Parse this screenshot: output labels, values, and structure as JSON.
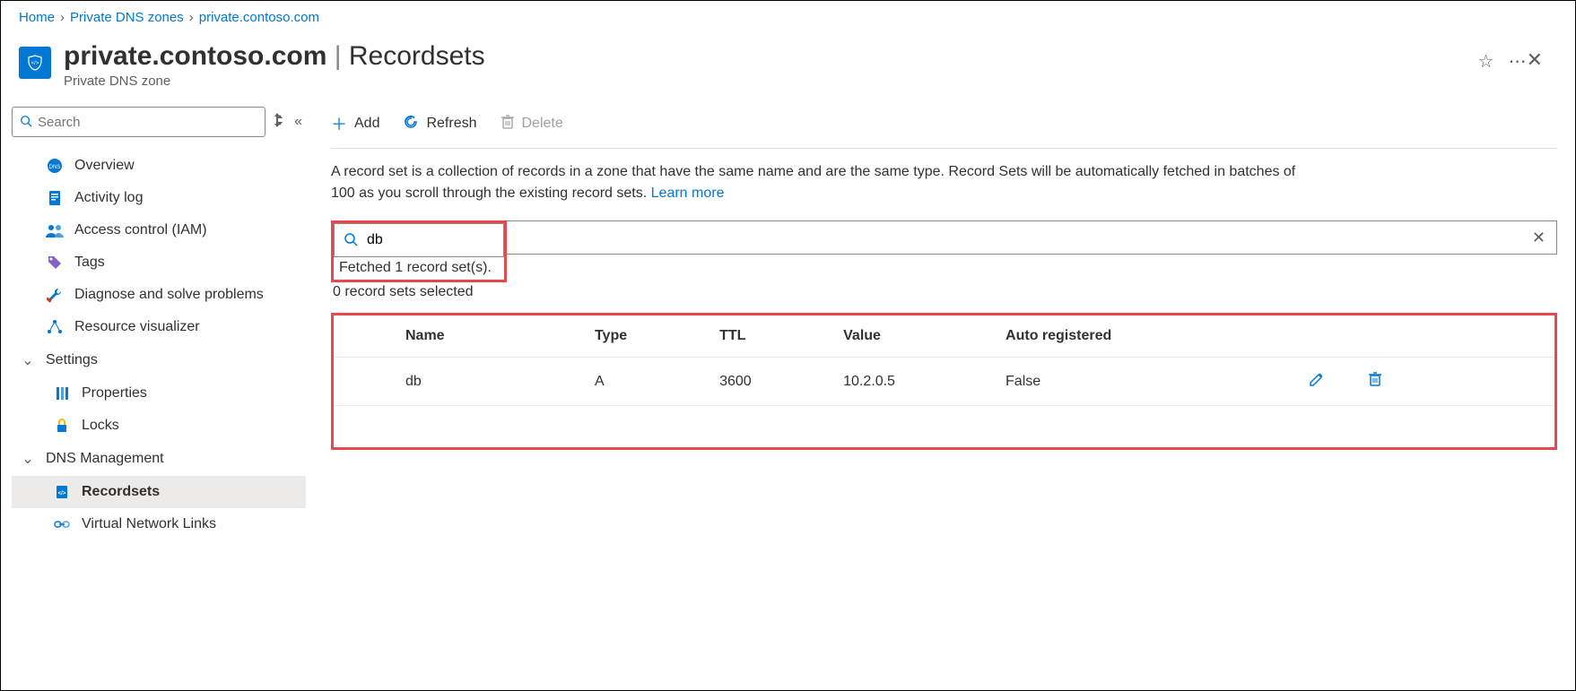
{
  "breadcrumb": {
    "items": [
      "Home",
      "Private DNS zones",
      "private.contoso.com"
    ]
  },
  "header": {
    "resource_name": "private.contoso.com",
    "section": "Recordsets",
    "subtitle": "Private DNS zone"
  },
  "sidebar": {
    "search_placeholder": "Search",
    "items": [
      {
        "label": "Overview"
      },
      {
        "label": "Activity log"
      },
      {
        "label": "Access control (IAM)"
      },
      {
        "label": "Tags"
      },
      {
        "label": "Diagnose and solve problems"
      },
      {
        "label": "Resource visualizer"
      }
    ],
    "groups": [
      {
        "label": "Settings",
        "items": [
          {
            "label": "Properties"
          },
          {
            "label": "Locks"
          }
        ]
      },
      {
        "label": "DNS Management",
        "items": [
          {
            "label": "Recordsets",
            "active": true
          },
          {
            "label": "Virtual Network Links"
          }
        ]
      }
    ]
  },
  "toolbar": {
    "add_label": "Add",
    "refresh_label": "Refresh",
    "delete_label": "Delete"
  },
  "description": {
    "text": "A record set is a collection of records in a zone that have the same name and are the same type. Record Sets will be automatically fetched in batches of 100 as you scroll through the existing record sets.",
    "learn_more": "Learn more"
  },
  "record_search": {
    "value": "db",
    "fetched_text": "Fetched 1 record set(s).",
    "selected_text": "0 record sets selected"
  },
  "table": {
    "columns": [
      "Name",
      "Type",
      "TTL",
      "Value",
      "Auto registered"
    ],
    "rows": [
      {
        "name": "db",
        "type": "A",
        "ttl": "3600",
        "value": "10.2.0.5",
        "auto": "False"
      }
    ]
  }
}
